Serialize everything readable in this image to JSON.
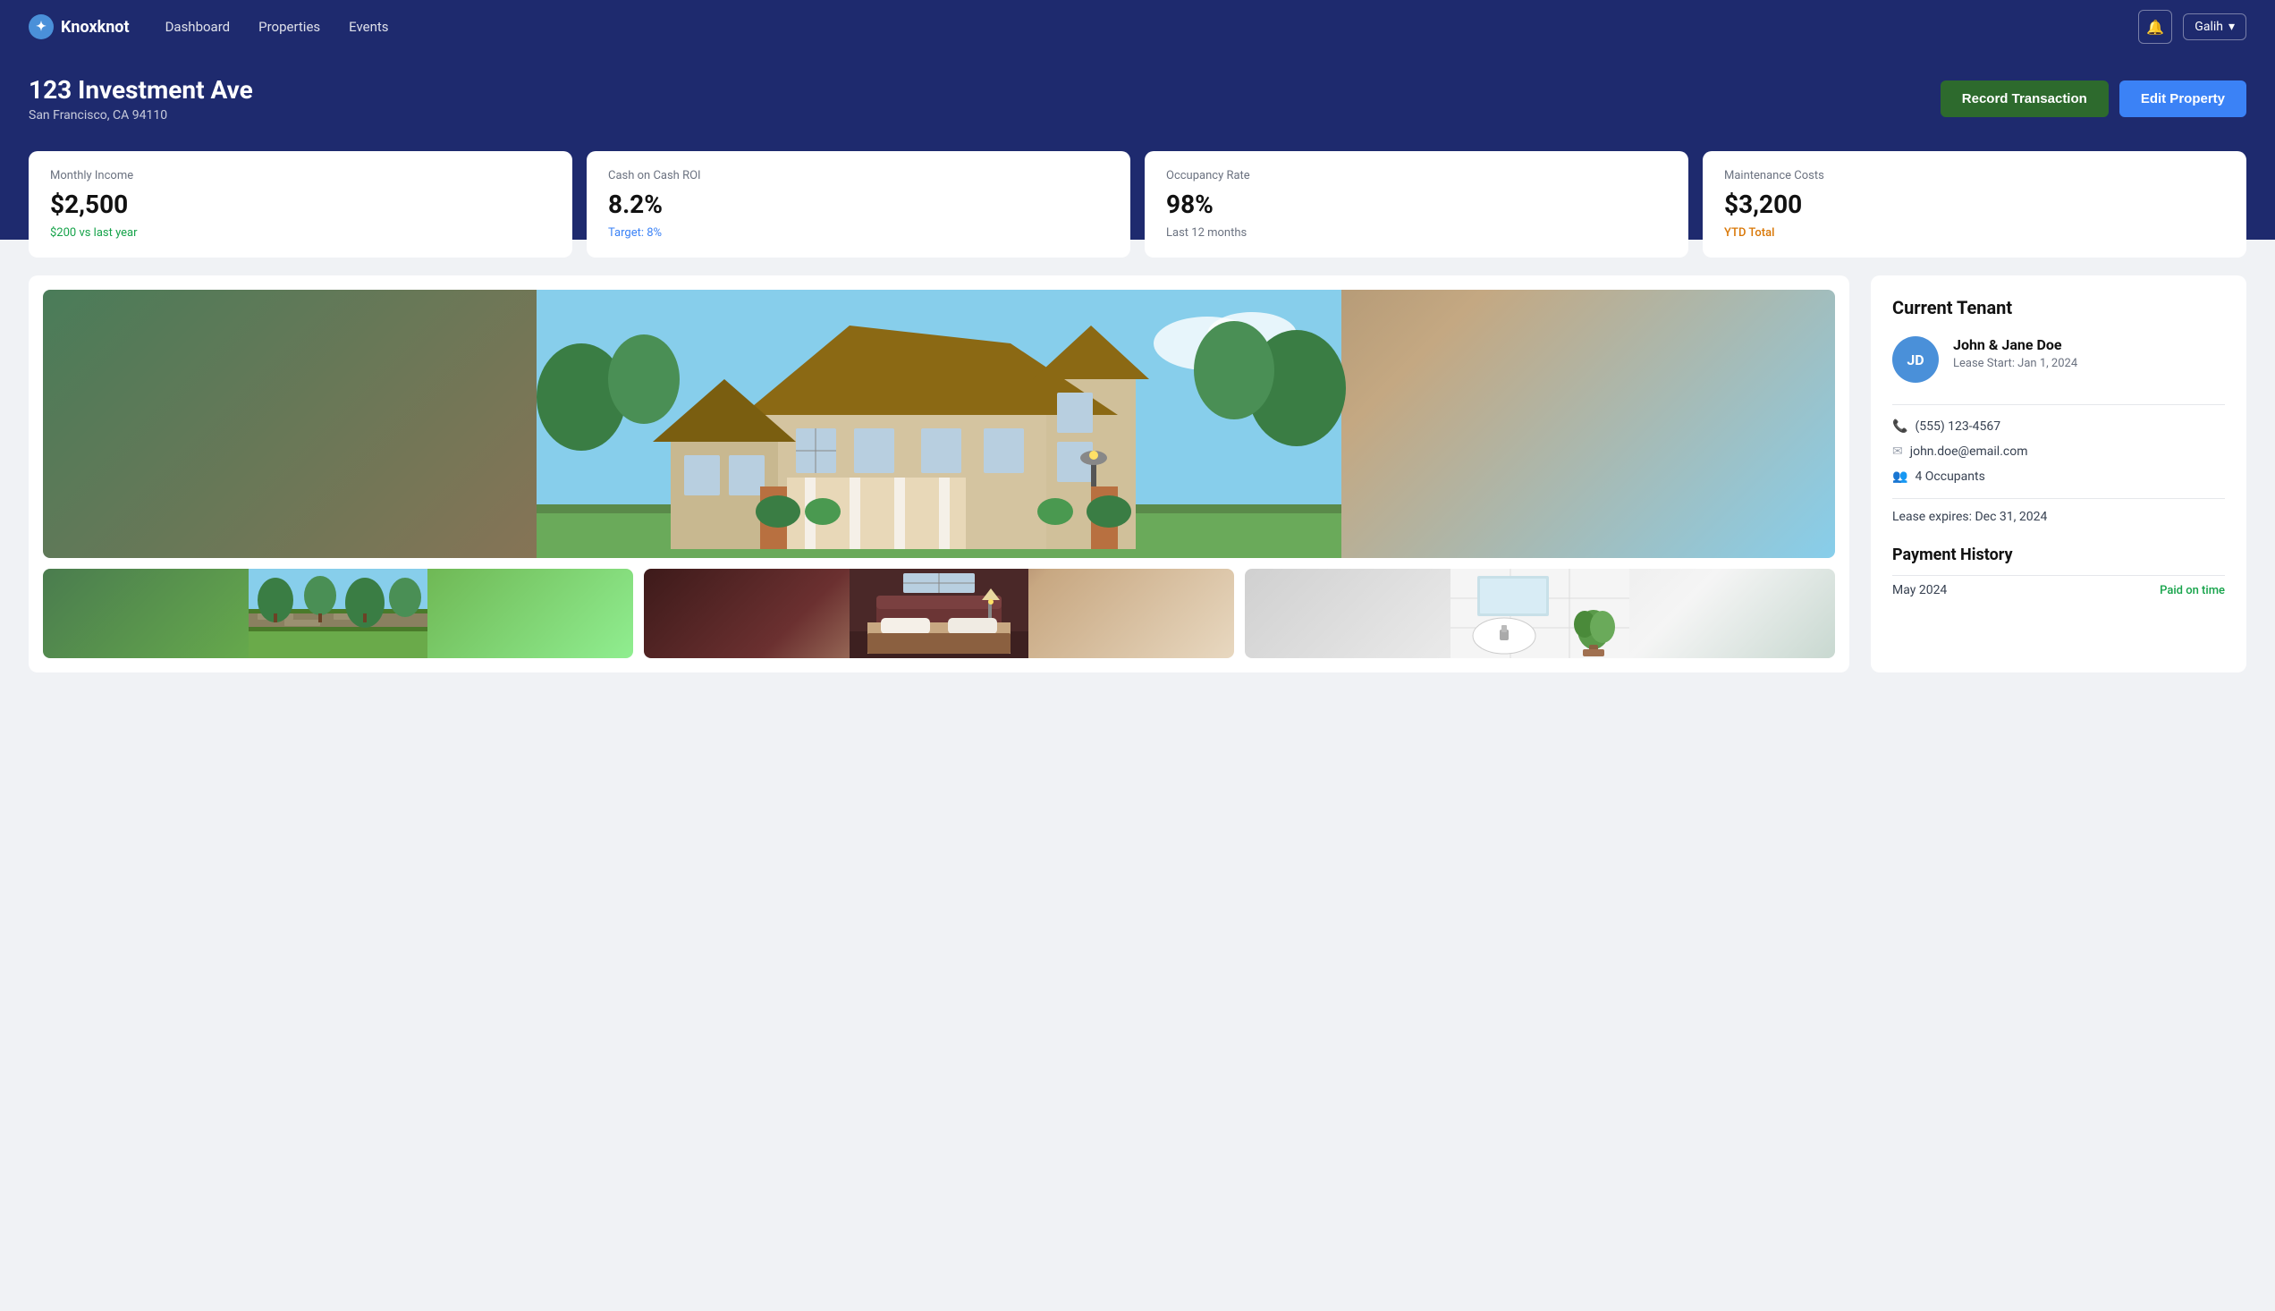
{
  "app": {
    "brand": "Knoxknot",
    "logo_initial": "✦"
  },
  "nav": {
    "links": [
      {
        "label": "Dashboard",
        "id": "dashboard"
      },
      {
        "label": "Properties",
        "id": "properties"
      },
      {
        "label": "Events",
        "id": "events"
      }
    ],
    "bell_icon": "🔔",
    "user_name": "Galih",
    "user_chevron": "▾"
  },
  "hero": {
    "title": "123 Investment Ave",
    "subtitle": "San Francisco, CA 94110",
    "record_btn": "Record Transaction",
    "edit_btn": "Edit Property"
  },
  "metrics": [
    {
      "id": "monthly-income",
      "label": "Monthly Income",
      "value": "$2,500",
      "sub": "$200 vs last year",
      "sub_color": "green"
    },
    {
      "id": "cash-on-cash",
      "label": "Cash on Cash ROI",
      "value": "8.2%",
      "sub": "Target: 8%",
      "sub_color": "blue"
    },
    {
      "id": "occupancy-rate",
      "label": "Occupancy Rate",
      "value": "98%",
      "sub": "Last 12 months",
      "sub_color": "gray"
    },
    {
      "id": "maintenance-costs",
      "label": "Maintenance Costs",
      "value": "$3,200",
      "sub": "YTD Total",
      "sub_color": "orange"
    }
  ],
  "tenant": {
    "section_title": "Current Tenant",
    "avatar_initials": "JD",
    "name": "John & Jane Doe",
    "lease_start": "Lease Start: Jan 1, 2024",
    "phone": "(555) 123-4567",
    "email": "john.doe@email.com",
    "occupants": "4 Occupants",
    "lease_expires": "Lease expires: Dec 31, 2024"
  },
  "payment_history": {
    "section_title": "Payment History",
    "entries": [
      {
        "month": "May 2024",
        "status": "Paid on time",
        "status_color": "green"
      }
    ]
  },
  "images": {
    "main_alt": "Front exterior of 123 Investment Ave",
    "thumb1_alt": "Garden view",
    "thumb2_alt": "Bedroom",
    "thumb3_alt": "Bathroom"
  }
}
